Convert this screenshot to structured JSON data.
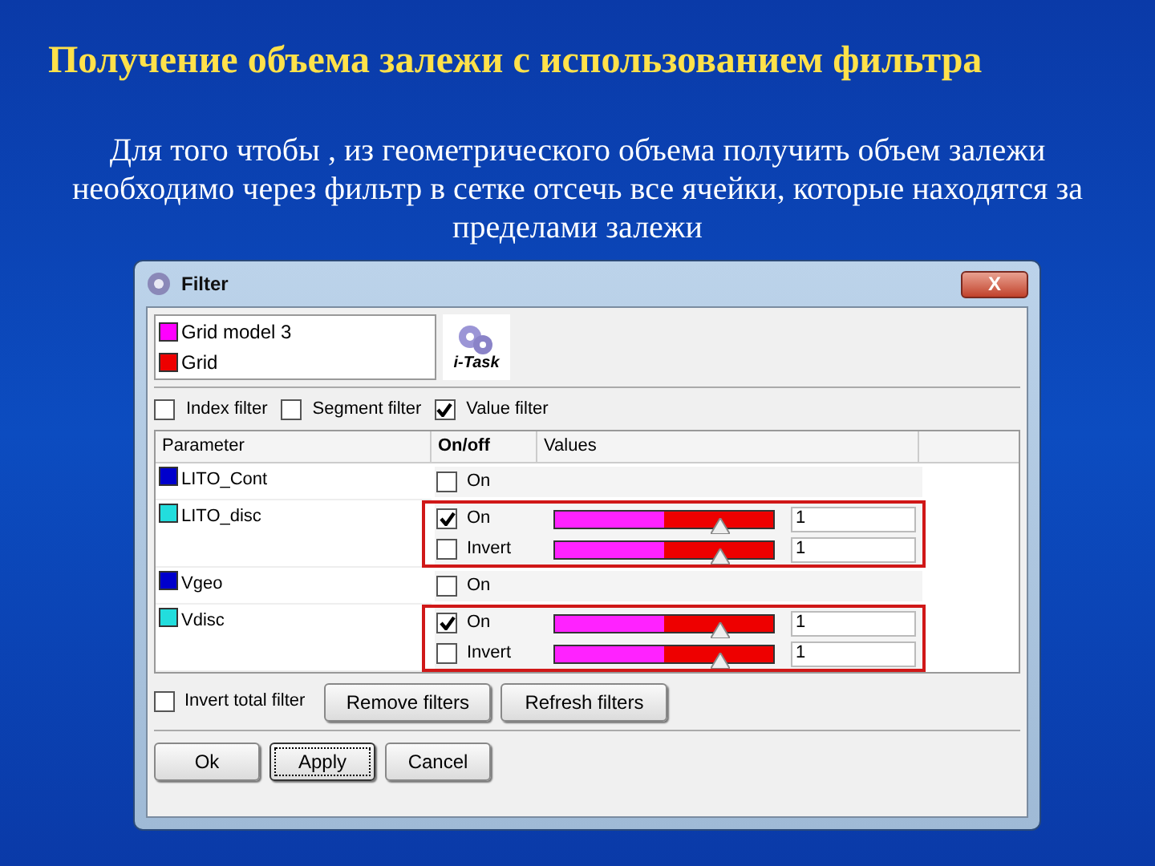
{
  "slide": {
    "title": "Получение объема залежи с использованием фильтра",
    "body": "Для того чтобы , из геометрического объема получить объем залежи необходимо через фильтр в сетке отсечь все ячейки, которые находятся за пределами залежи"
  },
  "dialog": {
    "title": "Filter",
    "close": "X",
    "models": [
      {
        "name": "Grid model 3",
        "color": "#ff00ff"
      },
      {
        "name": "Grid",
        "color": "#ee0000"
      }
    ],
    "logo": "i-Task",
    "filters": [
      {
        "label": "Index filter",
        "checked": false
      },
      {
        "label": "Segment filter",
        "checked": false
      },
      {
        "label": "Value filter",
        "checked": true
      }
    ],
    "table": {
      "columns": [
        "Parameter",
        "On/off",
        "Values"
      ],
      "rows": [
        {
          "name": "LITO_Cont",
          "color": "#0000cc",
          "highlighted": false,
          "controls": [
            {
              "kind": "toggle",
              "label": "On",
              "checked": false
            }
          ]
        },
        {
          "name": "LITO_disc",
          "color": "#22dddd",
          "highlighted": true,
          "controls": [
            {
              "kind": "range",
              "label": "On",
              "checked": true,
              "level": 0.76,
              "value": "1"
            },
            {
              "kind": "range",
              "label": "Invert",
              "checked": false,
              "level": 0.76,
              "value": "1"
            }
          ]
        },
        {
          "name": "Vgeo",
          "color": "#0000cc",
          "highlighted": false,
          "controls": [
            {
              "kind": "toggle",
              "label": "On",
              "checked": false
            }
          ]
        },
        {
          "name": "Vdisc",
          "color": "#22dddd",
          "highlighted": true,
          "controls": [
            {
              "kind": "range",
              "label": "On",
              "checked": true,
              "level": 0.76,
              "value": "1"
            },
            {
              "kind": "range",
              "label": "Invert",
              "checked": false,
              "level": 0.76,
              "value": "1"
            }
          ]
        }
      ]
    },
    "invert_total": {
      "label": "Invert total filter",
      "checked": false
    },
    "actions": [
      {
        "label": "Remove filters",
        "focused": false
      },
      {
        "label": "Refresh filters",
        "focused": false
      }
    ],
    "buttons": [
      {
        "label": "Ok",
        "focused": false
      },
      {
        "label": "Apply",
        "focused": true
      },
      {
        "label": "Cancel",
        "focused": false
      }
    ]
  }
}
